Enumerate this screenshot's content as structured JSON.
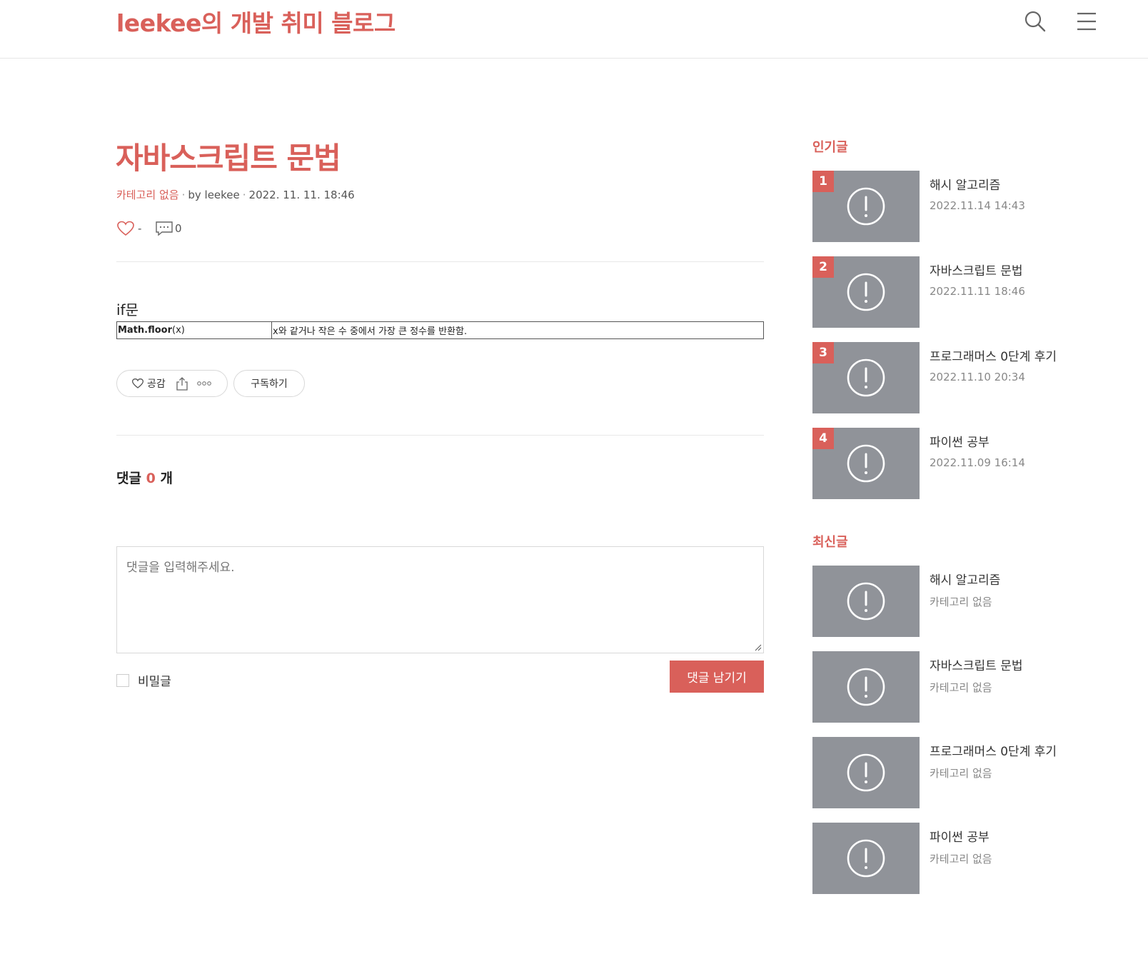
{
  "header": {
    "blog_title": "leekee의 개발 취미 블로그",
    "search_icon": "search-icon",
    "menu_icon": "hamburger-menu-icon"
  },
  "post": {
    "title": "자바스크립트 문법",
    "category": "카테고리 없음",
    "author": "by leekee",
    "date": "2022. 11. 11. 18:46",
    "like_count": "-",
    "comment_count": "0",
    "content_heading": "if문",
    "table": [
      {
        "code_bold": "Math.floor",
        "code_rest": "(x)",
        "description": "x와 같거나 작은 수 중에서 가장 큰 정수를 반환함."
      }
    ],
    "like_label": "공감",
    "subscribe_label": "구독하기"
  },
  "comments": {
    "label_prefix": "댓글",
    "count": "0",
    "label_suffix": "개",
    "placeholder": "댓글을 입력해주세요.",
    "secret_label": "비밀글",
    "submit_label": "댓글 남기기"
  },
  "sidebar": {
    "popular_heading": "인기글",
    "popular": [
      {
        "rank": "1",
        "title": "해시 알고리즘",
        "sub": "2022.11.14 14:43"
      },
      {
        "rank": "2",
        "title": "자바스크립트 문법",
        "sub": "2022.11.11 18:46"
      },
      {
        "rank": "3",
        "title": "프로그래머스 0단계 후기",
        "sub": "2022.11.10 20:34"
      },
      {
        "rank": "4",
        "title": "파이썬 공부",
        "sub": "2022.11.09 16:14"
      }
    ],
    "recent_heading": "최신글",
    "recent": [
      {
        "title": "해시 알고리즘",
        "sub": "카테고리 없음"
      },
      {
        "title": "자바스크립트 문법",
        "sub": "카테고리 없음"
      },
      {
        "title": "프로그래머스 0단계 후기",
        "sub": "카테고리 없음"
      },
      {
        "title": "파이썬 공부",
        "sub": "카테고리 없음"
      }
    ]
  },
  "colors": {
    "accent": "#d9605a",
    "thumb": "#909399"
  }
}
